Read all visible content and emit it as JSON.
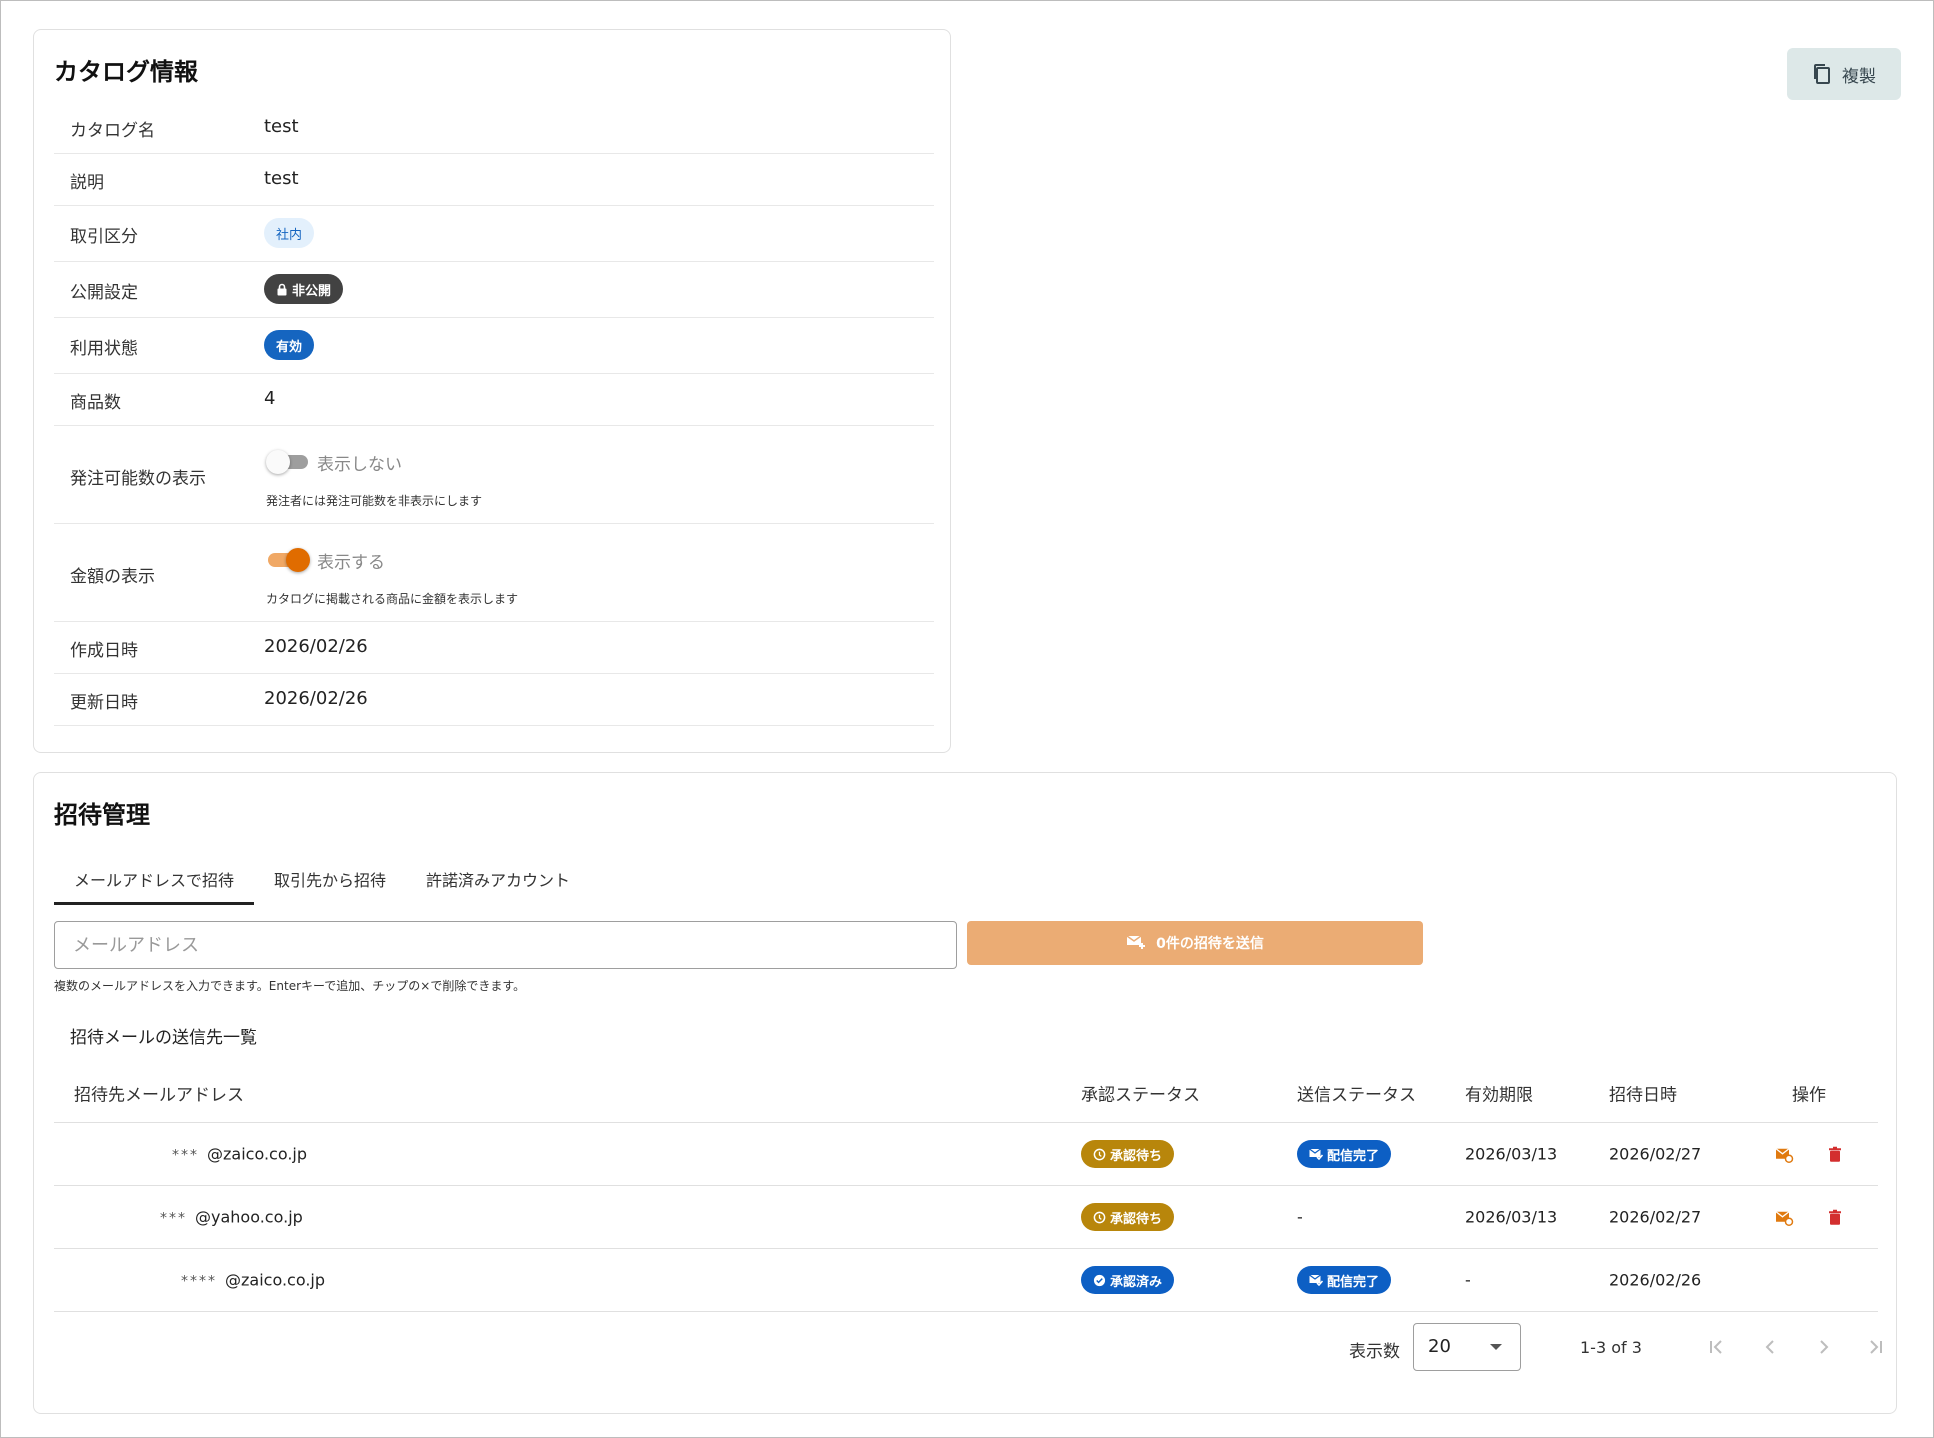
{
  "catalog": {
    "title": "カタログ情報",
    "rows": {
      "name": {
        "label": "カタログ名",
        "value": "test"
      },
      "description": {
        "label": "説明",
        "value": "test"
      },
      "trade_type": {
        "label": "取引区分",
        "value": "社内"
      },
      "visibility": {
        "label": "公開設定",
        "value": "非公開"
      },
      "status": {
        "label": "利用状態",
        "value": "有効"
      },
      "product_count": {
        "label": "商品数",
        "value": "4"
      },
      "order_qty_display": {
        "label": "発注可能数の表示",
        "switch_label": "表示しない",
        "help": "発注者には発注可能数を非表示にします",
        "enabled": false
      },
      "price_display": {
        "label": "金額の表示",
        "switch_label": "表示する",
        "help": "カタログに掲載される商品に金額を表示します",
        "enabled": true
      },
      "created": {
        "label": "作成日時",
        "value": "2026/02/26"
      },
      "updated": {
        "label": "更新日時",
        "value": "2026/02/26"
      }
    }
  },
  "copy_button": {
    "label": "複製",
    "icon": "copy-icon"
  },
  "invite": {
    "title": "招待管理",
    "tabs": [
      {
        "label": "メールアドレスで招待",
        "active": true
      },
      {
        "label": "取引先から招待",
        "active": false
      },
      {
        "label": "許諾済みアカウント",
        "active": false
      }
    ],
    "email_placeholder": "メールアドレス",
    "send_button": "0件の招待を送信",
    "email_help": "複数のメールアドレスを入力できます。Enterキーで追加、チップの×で削除できます。",
    "list_title": "招待メールの送信先一覧",
    "columns": {
      "email": "招待先メールアドレス",
      "approval": "承認ステータス",
      "send": "送信ステータス",
      "expire": "有効期限",
      "invited": "招待日時",
      "ops": "操作"
    },
    "rows": [
      {
        "masked": "***",
        "domain": "@zaico.co.jp",
        "approval": "承認待ち",
        "send": "配信完了",
        "expire": "2026/03/13",
        "invited": "2026/02/27",
        "actions": true
      },
      {
        "masked": "***",
        "domain": "@yahoo.co.jp",
        "approval": "承認待ち",
        "send": "-",
        "expire": "2026/03/13",
        "invited": "2026/02/27",
        "actions": true
      },
      {
        "masked": "****",
        "domain": "@zaico.co.jp",
        "approval": "承認済み",
        "send": "配信完了",
        "expire": "-",
        "invited": "2026/02/26",
        "actions": false
      }
    ],
    "pager": {
      "label": "表示数",
      "per_page": "20",
      "range": "1-3 of 3"
    }
  },
  "colors": {
    "accent": "#e06c00",
    "primary": "#1565c0",
    "pending": "#b8860b",
    "danger": "#d32f2f"
  }
}
